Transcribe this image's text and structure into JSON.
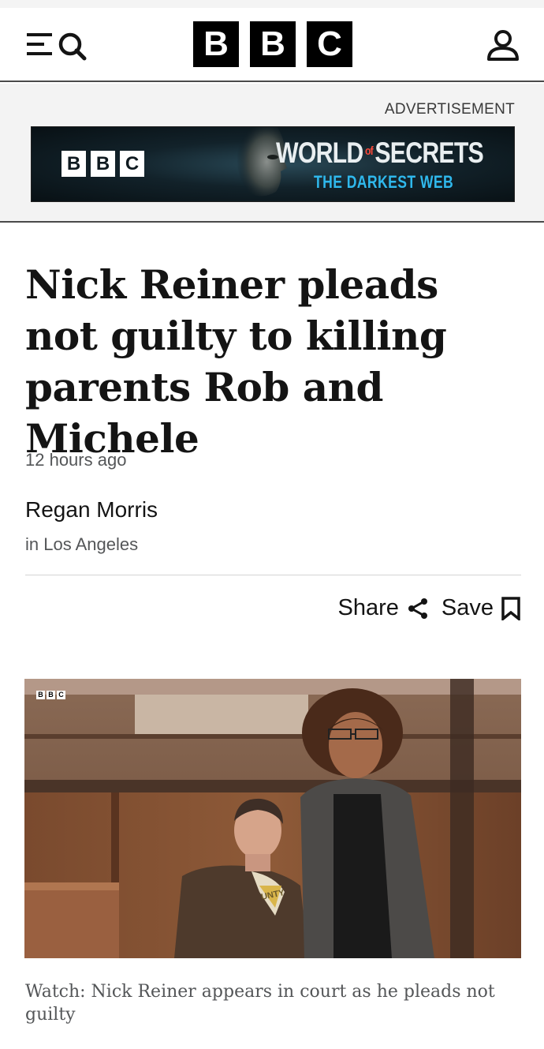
{
  "header": {
    "logo_letters": [
      "B",
      "B",
      "C"
    ],
    "icons": {
      "menu": "menu-icon",
      "search": "search-icon",
      "account": "account-icon"
    }
  },
  "advert": {
    "label": "ADVERTISEMENT",
    "brand_letters": [
      "B",
      "B",
      "C"
    ],
    "title_part1": "WORLD",
    "title_of": "of",
    "title_part2": "SECRETS",
    "subtitle": "THE DARKEST WEB"
  },
  "article": {
    "headline": "Nick Reiner pleads not guilty to killing parents Rob and Michele",
    "timestamp": "12 hours ago",
    "author": "Regan Morris",
    "location": "in Los Angeles",
    "actions": {
      "share_label": "Share",
      "share_icon": "share-icon",
      "save_label": "Save",
      "save_icon": "bookmark-icon"
    },
    "video": {
      "watermark_letters": [
        "B",
        "B",
        "C"
      ],
      "shirt_text": "UNTY",
      "caption": "Watch: Nick Reiner appears in court as he pleads not guilty"
    }
  },
  "colors": {
    "text": "#141414",
    "muted": "#545658",
    "logo_block": "#000000",
    "ad_title": "#e9eef0",
    "ad_subtitle": "#2fb8ec",
    "ad_of": "#ff4a3a"
  }
}
